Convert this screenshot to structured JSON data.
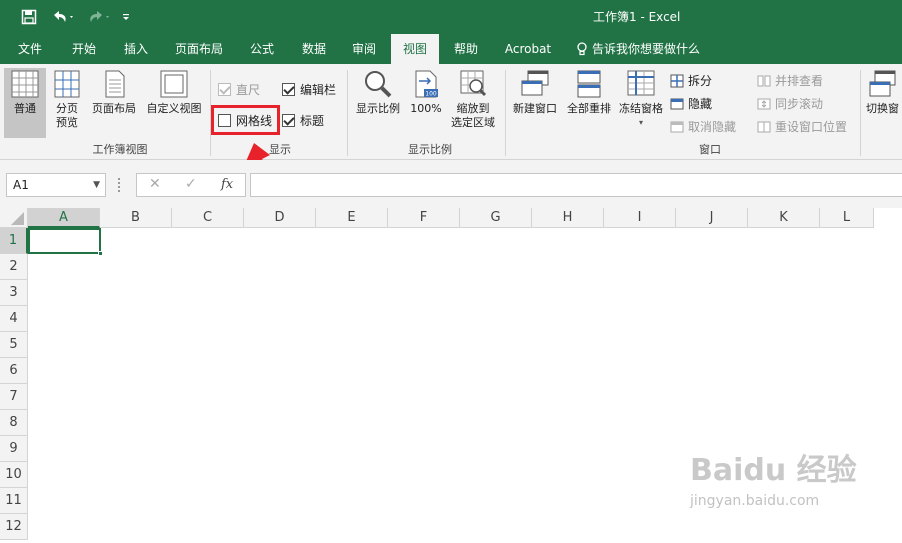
{
  "window": {
    "title": "工作簿1  -  Excel"
  },
  "tabs": [
    {
      "label": "文件"
    },
    {
      "label": "开始"
    },
    {
      "label": "插入"
    },
    {
      "label": "页面布局"
    },
    {
      "label": "公式"
    },
    {
      "label": "数据"
    },
    {
      "label": "审阅"
    },
    {
      "label": "视图",
      "active": true
    },
    {
      "label": "帮助"
    },
    {
      "label": "Acrobat"
    },
    {
      "label": "告诉我你想要做什么"
    }
  ],
  "ribbon": {
    "workbook_views": {
      "label": "工作簿视图",
      "normal": "普通",
      "page_break_line1": "分页",
      "page_break_line2": "预览",
      "page_layout": "页面布局",
      "custom_views": "自定义视图"
    },
    "show": {
      "label": "显示",
      "ruler": "直尺",
      "formula_bar": "编辑栏",
      "gridlines": "网格线",
      "headings": "标题"
    },
    "zoom": {
      "label": "显示比例",
      "zoom": "显示比例",
      "zoom100": "100%",
      "zoom100_badge": "100",
      "zoom_selection_line1": "缩放到",
      "zoom_selection_line2": "选定区域"
    },
    "window": {
      "label": "窗口",
      "new_window": "新建窗口",
      "arrange_all": "全部重排",
      "freeze_panes": "冻结窗格",
      "split": "拆分",
      "hide": "隐藏",
      "unhide": "取消隐藏",
      "side_by_side": "并排查看",
      "sync_scroll": "同步滚动",
      "reset_position": "重设窗口位置",
      "switch_windows": "切换窗"
    }
  },
  "formula_bar": {
    "name_box": "A1",
    "cancel": "✕",
    "enter": "✓",
    "fx": "fx",
    "content": ""
  },
  "sheet": {
    "columns": [
      "A",
      "B",
      "C",
      "D",
      "E",
      "F",
      "G",
      "H",
      "I",
      "J",
      "K",
      "L"
    ],
    "rows": [
      "1",
      "2",
      "3",
      "4",
      "5",
      "6",
      "7",
      "8",
      "9",
      "10",
      "11",
      "12"
    ],
    "active_cell": "A1"
  },
  "watermark": {
    "brand": "Baidu 经验",
    "url": "jingyan.baidu.com"
  },
  "colors": {
    "accent": "#217346",
    "highlight": "#e8222b"
  }
}
